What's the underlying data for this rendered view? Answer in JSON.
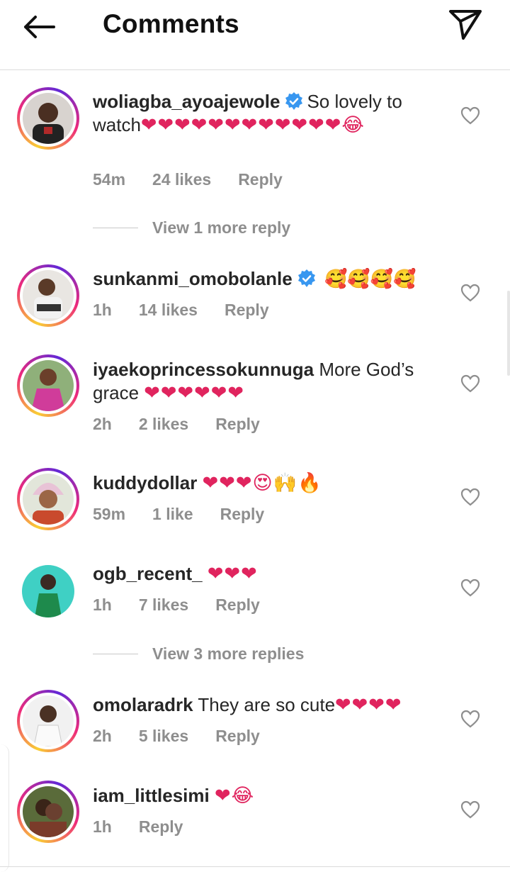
{
  "header": {
    "title": "Comments",
    "back_icon": "arrow-left-icon",
    "send_icon": "paper-plane-icon"
  },
  "colors": {
    "heart": "#e0245e",
    "verified": "#3897f0",
    "meta_gray": "#8e8e8e",
    "text": "#262626"
  },
  "comments": [
    {
      "username": "woliagba_ayoajewole",
      "verified": true,
      "text": "So lovely to watch",
      "emoji": "❤❤❤❤❤❤❤❤❤❤❤❤😂",
      "time": "54m",
      "likes": "24 likes",
      "reply": "Reply"
    },
    {
      "username": "sunkanmi_omobolanle",
      "verified": true,
      "text": "",
      "emoji": "🥰🥰🥰🥰",
      "time": "1h",
      "likes": "14 likes",
      "reply": "Reply"
    },
    {
      "username": "iyaekoprincessokunnuga",
      "verified": false,
      "text": "More God’s grace",
      "emoji": "❤❤❤❤❤❤",
      "time": "2h",
      "likes": "2 likes",
      "reply": "Reply"
    },
    {
      "username": "kuddydollar",
      "verified": false,
      "text": "",
      "emoji": "❤❤❤😍🙌🔥",
      "time": "59m",
      "likes": "1 like",
      "reply": "Reply"
    },
    {
      "username": "ogb_recent_",
      "verified": false,
      "text": "",
      "emoji": "❤❤❤",
      "time": "1h",
      "likes": "7 likes",
      "reply": "Reply"
    },
    {
      "username": "omolaradrk",
      "verified": false,
      "text": "They are so cute",
      "emoji": "❤❤❤❤",
      "time": "2h",
      "likes": "5 likes",
      "reply": "Reply"
    },
    {
      "username": "iam_littlesimi",
      "verified": false,
      "text": "",
      "emoji": "❤😂",
      "time": "1h",
      "likes": "",
      "reply": "Reply"
    }
  ],
  "view_replies": [
    {
      "label": "View 1 more reply"
    },
    {
      "label": "View 3 more replies"
    }
  ]
}
